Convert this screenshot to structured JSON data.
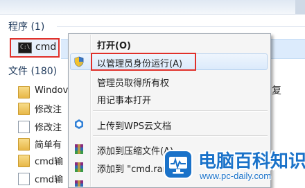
{
  "results": {
    "programs_header": "程序 (1)",
    "program_item": "cmd",
    "files_header": "文件 (180)",
    "files": [
      {
        "label": "Windov",
        "icon": "folder-icon"
      },
      {
        "label": "修改注",
        "icon": "folder-icon"
      },
      {
        "label": "修改注",
        "icon": "document-icon"
      },
      {
        "label": "简单有",
        "icon": "folder-icon"
      },
      {
        "label": "cmd输",
        "icon": "folder-icon"
      },
      {
        "label": "cmd输",
        "icon": "document-icon"
      }
    ],
    "right_fragment": "复"
  },
  "context_menu": {
    "items": [
      {
        "label": "打开(O)",
        "bold": true
      },
      {
        "label": "以管理员身份运行(A)",
        "icon": "uac-shield-icon"
      },
      {
        "label": "管理员取得所有权"
      },
      {
        "label": "用记事本打开"
      },
      {
        "label": "上传到WPS云文档",
        "icon": "wps-cloud-icon"
      },
      {
        "label": "添加到压缩文件(A)...",
        "icon": "winrar-icon"
      },
      {
        "label": "添加到 \"cmd.rar\"",
        "icon": "winrar-icon"
      }
    ]
  },
  "watermark": {
    "title": "电脑百科知识",
    "url": "www.pc-daily.com"
  },
  "colors": {
    "highlight_border": "#e0302a",
    "brand_blue": "#1a72c9"
  }
}
